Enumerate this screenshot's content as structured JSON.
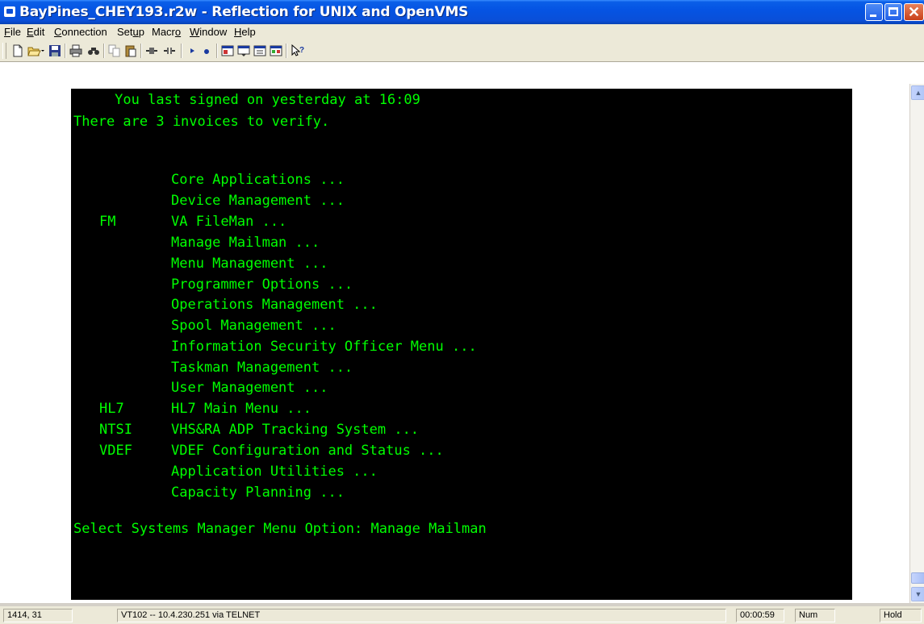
{
  "window": {
    "title": "BayPines_CHEY193.r2w - Reflection for UNIX and OpenVMS",
    "close_glyph": "✕"
  },
  "menu": {
    "items": [
      {
        "pre": "",
        "accel": "F",
        "post": "ile"
      },
      {
        "pre": "",
        "accel": "E",
        "post": "dit"
      },
      {
        "pre": "",
        "accel": "C",
        "post": "onnection"
      },
      {
        "pre": "Set",
        "accel": "u",
        "post": "p"
      },
      {
        "pre": "Macr",
        "accel": "o",
        "post": ""
      },
      {
        "pre": "",
        "accel": "W",
        "post": "indow"
      },
      {
        "pre": "",
        "accel": "H",
        "post": "elp"
      }
    ]
  },
  "toolbar": {
    "icons": [
      "new-icon",
      "open-icon",
      "save-icon",
      "print-icon",
      "find-icon",
      "copy-icon",
      "paste-icon",
      "connect-icon",
      "disconnect-icon",
      "play-macro-icon",
      "record-macro-icon",
      "setup-1-icon",
      "setup-2-icon",
      "setup-3-icon",
      "setup-4-icon",
      "help-pointer-icon"
    ]
  },
  "terminal": {
    "header_line1": "     You last signed on yesterday at 16:09",
    "header_line2": "There are 3 invoices to verify.",
    "menu_items": [
      {
        "mnemonic": "",
        "label": "Core Applications ..."
      },
      {
        "mnemonic": "",
        "label": "Device Management ..."
      },
      {
        "mnemonic": "FM",
        "label": "VA FileMan ..."
      },
      {
        "mnemonic": "",
        "label": "Manage Mailman ..."
      },
      {
        "mnemonic": "",
        "label": "Menu Management ..."
      },
      {
        "mnemonic": "",
        "label": "Programmer Options ..."
      },
      {
        "mnemonic": "",
        "label": "Operations Management ..."
      },
      {
        "mnemonic": "",
        "label": "Spool Management ..."
      },
      {
        "mnemonic": "",
        "label": "Information Security Officer Menu ..."
      },
      {
        "mnemonic": "",
        "label": "Taskman Management ..."
      },
      {
        "mnemonic": "",
        "label": "User Management ..."
      },
      {
        "mnemonic": "HL7",
        "label": "HL7 Main Menu ..."
      },
      {
        "mnemonic": "NTSI",
        "label": "VHS&RA ADP Tracking System ..."
      },
      {
        "mnemonic": "VDEF",
        "label": "VDEF Configuration and Status ..."
      },
      {
        "mnemonic": "",
        "label": "Application Utilities ..."
      },
      {
        "mnemonic": "",
        "label": "Capacity Planning ..."
      }
    ],
    "prompt": "Select Systems Manager Menu Option: Manage Mailman",
    "foreground_color": "#00ff00",
    "background_color": "#000000"
  },
  "statusbar": {
    "cursor_position": "1414, 31",
    "connection": "VT102 -- 10.4.230.251 via TELNET",
    "elapsed_time": "00:00:59",
    "num_lock": "Num",
    "hold": "Hold"
  }
}
